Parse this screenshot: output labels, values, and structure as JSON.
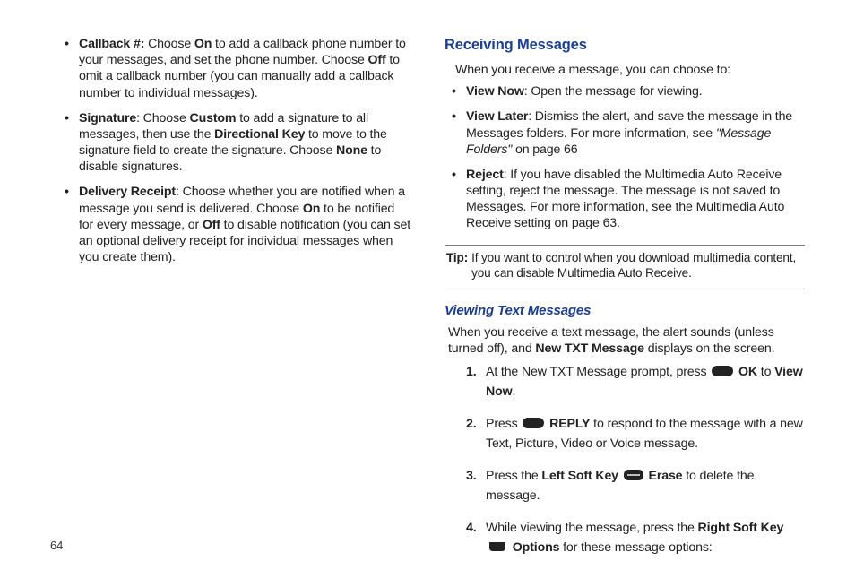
{
  "left": {
    "items": [
      {
        "label": "Callback #:",
        "before": "Choose ",
        "kw1": "On",
        "mid1": " to add a callback phone number to your messages, and set the phone number. Choose ",
        "kw2": "Off",
        "after": " to omit a callback number (you can manually add a callback number to individual messages)."
      },
      {
        "label": "Signature",
        "before": ": Choose ",
        "kw1": "Custom",
        "mid1": " to add a signature to all messages, then use the ",
        "kw2": "Directional Key",
        "mid2": " to move to the signature field to create the signature. Choose ",
        "kw3": "None",
        "after": " to disable signatures."
      },
      {
        "label": "Delivery Receipt",
        "before": ": Choose whether you are notified when a message you send is delivered. Choose ",
        "kw1": "On",
        "mid1": " to be notified for every message, or ",
        "kw2": "Off",
        "after": " to disable notification (you can set an optional delivery receipt for individual messages when you create them)."
      }
    ]
  },
  "right": {
    "heading1": "Receiving Messages",
    "intro1": "When you receive a message, you can choose to:",
    "recvItems": [
      {
        "label": "View Now",
        "text": ": Open the message for viewing."
      },
      {
        "label": "View Later",
        "text": ": Dismiss the alert, and save the message in the Messages folders. For more information, see ",
        "ital": "\"Message Folders\"",
        "tail": " on page 66"
      },
      {
        "label": " Reject",
        "text": ": If you have disabled the Multimedia Auto Receive setting, reject the message. The message is not saved to Messages. For more information, see the Multimedia Auto Receive setting on page 63."
      }
    ],
    "tipLabel": "Tip:",
    "tipBody": "If you want to control when you download multimedia content, you can disable Multimedia Auto Receive.",
    "heading2": "Viewing Text Messages",
    "intro2a": "When you receive a text message, the alert sounds (unless turned off), and ",
    "intro2b": "New TXT Message",
    "intro2c": " displays on the screen.",
    "steps": {
      "s1a": "At the New TXT Message prompt, press ",
      "s1key": "OK",
      "s1b": " to ",
      "s1c": "View Now",
      "s1d": ".",
      "s2a": "Press ",
      "s2key": "REPLY",
      "s2b": " to respond to the message with a new Text, Picture, Video or Voice message.",
      "s3a": "Press the ",
      "s3b": "Left Soft Key",
      "s3key": "Erase",
      "s3c": " to delete the message.",
      "s4a": "While viewing the message, press the ",
      "s4b": "Right Soft Key",
      "s4key": "Options",
      "s4c": " for these message options:"
    }
  },
  "pageNumber": "64"
}
